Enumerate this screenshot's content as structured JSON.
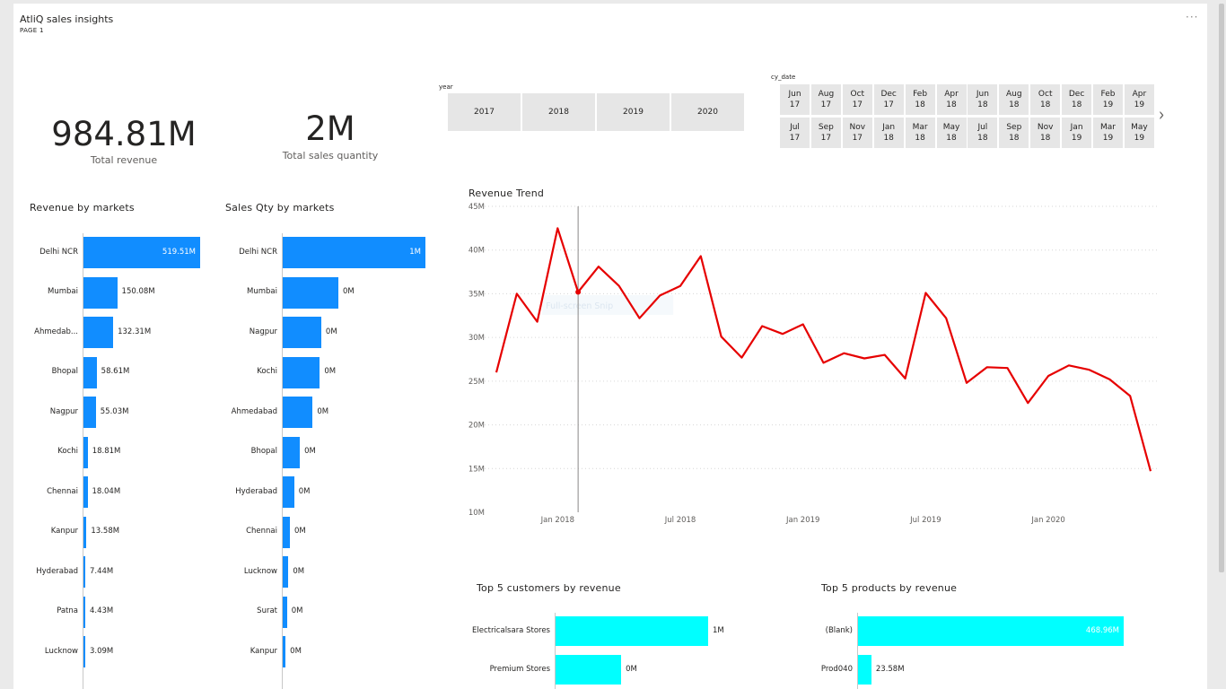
{
  "header": {
    "title": "AtliQ sales insights",
    "page_label": "PAGE 1",
    "more_label": "···"
  },
  "kpis": {
    "revenue": {
      "value": "984.81M",
      "label": "Total revenue"
    },
    "quantity": {
      "value": "2M",
      "label": "Total sales quantity"
    }
  },
  "year_slicer": {
    "title": "year",
    "options": [
      "2017",
      "2018",
      "2019",
      "2020"
    ]
  },
  "date_slicer": {
    "title": "cy_date",
    "row1": [
      [
        "Jun",
        "17"
      ],
      [
        "Aug",
        "17"
      ],
      [
        "Oct",
        "17"
      ],
      [
        "Dec",
        "17"
      ],
      [
        "Feb",
        "18"
      ],
      [
        "Apr",
        "18"
      ],
      [
        "Jun",
        "18"
      ],
      [
        "Aug",
        "18"
      ],
      [
        "Oct",
        "18"
      ],
      [
        "Dec",
        "18"
      ],
      [
        "Feb",
        "19"
      ],
      [
        "Apr",
        "19"
      ]
    ],
    "row2": [
      [
        "Jul",
        "17"
      ],
      [
        "Sep",
        "17"
      ],
      [
        "Nov",
        "17"
      ],
      [
        "Jan",
        "18"
      ],
      [
        "Mar",
        "18"
      ],
      [
        "May",
        "18"
      ],
      [
        "Jul",
        "18"
      ],
      [
        "Sep",
        "18"
      ],
      [
        "Nov",
        "18"
      ],
      [
        "Jan",
        "19"
      ],
      [
        "Mar",
        "19"
      ],
      [
        "May",
        "19"
      ]
    ],
    "next_icon": "chevron-right-icon"
  },
  "watermark": "Full-screen Snip",
  "colors": {
    "bar": "#118dff",
    "line": "#e60000",
    "cyan": "#00ffff",
    "slicer": "#e6e6e6"
  },
  "chart_data": [
    {
      "type": "bar",
      "orientation": "horizontal",
      "title": "Revenue by markets",
      "categories": [
        "Delhi NCR",
        "Mumbai",
        "Ahmedab...",
        "Bhopal",
        "Nagpur",
        "Kochi",
        "Chennai",
        "Kanpur",
        "Hyderabad",
        "Patna",
        "Lucknow"
      ],
      "values": [
        519.51,
        150.08,
        132.31,
        58.61,
        55.03,
        18.81,
        18.04,
        13.58,
        7.44,
        4.43,
        3.09
      ],
      "value_labels": [
        "519.51M",
        "150.08M",
        "132.31M",
        "58.61M",
        "55.03M",
        "18.81M",
        "18.04M",
        "13.58M",
        "7.44M",
        "4.43M",
        "3.09M"
      ],
      "unit": "M"
    },
    {
      "type": "bar",
      "orientation": "horizontal",
      "title": "Sales Qty by markets",
      "categories": [
        "Delhi NCR",
        "Mumbai",
        "Nagpur",
        "Kochi",
        "Ahmedabad",
        "Bhopal",
        "Hyderabad",
        "Chennai",
        "Lucknow",
        "Surat",
        "Kanpur"
      ],
      "values": [
        1.0,
        0.39,
        0.27,
        0.26,
        0.21,
        0.12,
        0.08,
        0.05,
        0.04,
        0.03,
        0.02
      ],
      "value_labels": [
        "1M",
        "0M",
        "0M",
        "0M",
        "0M",
        "0M",
        "0M",
        "0M",
        "0M",
        "0M",
        "0M"
      ],
      "unit": "M"
    },
    {
      "type": "line",
      "title": "Revenue Trend",
      "x": [
        "2017-10",
        "2017-11",
        "2017-12",
        "2018-01",
        "2018-02",
        "2018-03",
        "2018-04",
        "2018-05",
        "2018-06",
        "2018-07",
        "2018-08",
        "2018-09",
        "2018-10",
        "2018-11",
        "2018-12",
        "2019-01",
        "2019-02",
        "2019-03",
        "2019-04",
        "2019-05",
        "2019-06",
        "2019-07",
        "2019-08",
        "2019-09",
        "2019-10",
        "2019-11",
        "2019-12",
        "2020-01",
        "2020-02",
        "2020-03",
        "2020-04",
        "2020-05",
        "2020-06"
      ],
      "values": [
        26.0,
        35.0,
        31.8,
        42.5,
        35.2,
        38.1,
        35.9,
        32.2,
        34.8,
        35.9,
        39.3,
        30.1,
        27.7,
        31.3,
        30.4,
        31.5,
        27.1,
        28.2,
        27.6,
        28.0,
        25.3,
        35.1,
        32.2,
        24.8,
        26.6,
        26.5,
        22.5,
        25.6,
        26.8,
        26.3,
        25.2,
        23.3,
        14.7
      ],
      "x_ticks": [
        "Jan 2018",
        "Jul 2018",
        "Jan 2019",
        "Jul 2019",
        "Jan 2020"
      ],
      "y_ticks": [
        "10M",
        "15M",
        "20M",
        "25M",
        "30M",
        "35M",
        "40M",
        "45M"
      ],
      "ylim": [
        10,
        45
      ],
      "grid": true,
      "hover_index": 4
    },
    {
      "type": "bar",
      "orientation": "horizontal",
      "title": "Top 5 customers by revenue",
      "categories": [
        "Electricalsara Stores",
        "Premium Stores"
      ],
      "values": [
        1.0,
        0.43
      ],
      "value_labels": [
        "1M",
        "0M"
      ],
      "unit": "M"
    },
    {
      "type": "bar",
      "orientation": "horizontal",
      "title": "Top 5 products by revenue",
      "categories": [
        "(Blank)",
        "Prod040"
      ],
      "values": [
        468.96,
        23.58
      ],
      "value_labels": [
        "468.96M",
        "23.58M"
      ],
      "unit": "M"
    }
  ]
}
